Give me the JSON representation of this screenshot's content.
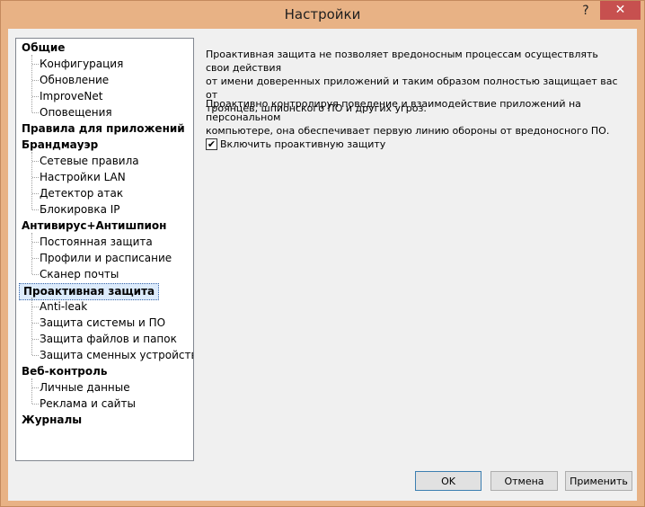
{
  "window": {
    "title": "Настройки",
    "help_label": "?",
    "close_label": "✕"
  },
  "tree": [
    {
      "label": "Общие",
      "type": "group"
    },
    {
      "label": "Конфигурация",
      "type": "child"
    },
    {
      "label": "Обновление",
      "type": "child"
    },
    {
      "label": "ImproveNet",
      "type": "child"
    },
    {
      "label": "Оповещения",
      "type": "child"
    },
    {
      "label": "Правила для приложений",
      "type": "group"
    },
    {
      "label": "Брандмауэр",
      "type": "group"
    },
    {
      "label": "Сетевые правила",
      "type": "child"
    },
    {
      "label": "Настройки LAN",
      "type": "child"
    },
    {
      "label": "Детектор атак",
      "type": "child"
    },
    {
      "label": "Блокировка IP",
      "type": "child"
    },
    {
      "label": "Антивирус+Антишпион",
      "type": "group"
    },
    {
      "label": "Постоянная защита",
      "type": "child"
    },
    {
      "label": "Профили и расписание",
      "type": "child"
    },
    {
      "label": "Сканер почты",
      "type": "child"
    },
    {
      "label": "Проактивная защита",
      "type": "group",
      "selected": true
    },
    {
      "label": "Anti-leak",
      "type": "child"
    },
    {
      "label": "Защита системы и ПО",
      "type": "child"
    },
    {
      "label": "Защита файлов и папок",
      "type": "child"
    },
    {
      "label": "Защита сменных устройств",
      "type": "child"
    },
    {
      "label": "Веб-контроль",
      "type": "group"
    },
    {
      "label": "Личные данные",
      "type": "child"
    },
    {
      "label": "Реклама и сайты",
      "type": "child"
    },
    {
      "label": "Журналы",
      "type": "group"
    }
  ],
  "content": {
    "para1_line1": "Проактивная защита не позволяет вредоносным процессам осуществлять свои действия",
    "para1_line2": "от имени доверенных приложений и таким образом полностью защищает вас от",
    "para1_line3": "троянцев, шпионского ПО и других угроз.",
    "para2_line1": "Проактивно контролируя поведение и взаимодействие приложений на персональном",
    "para2_line2": "компьютере, она обеспечивает первую линию обороны от вредоносного ПО.",
    "checkbox_label": "Включить проактивную защиту",
    "checkbox_checked": true,
    "checkbox_mark": "✔"
  },
  "buttons": {
    "ok": "OK",
    "cancel": "Отмена",
    "apply": "Применить"
  }
}
